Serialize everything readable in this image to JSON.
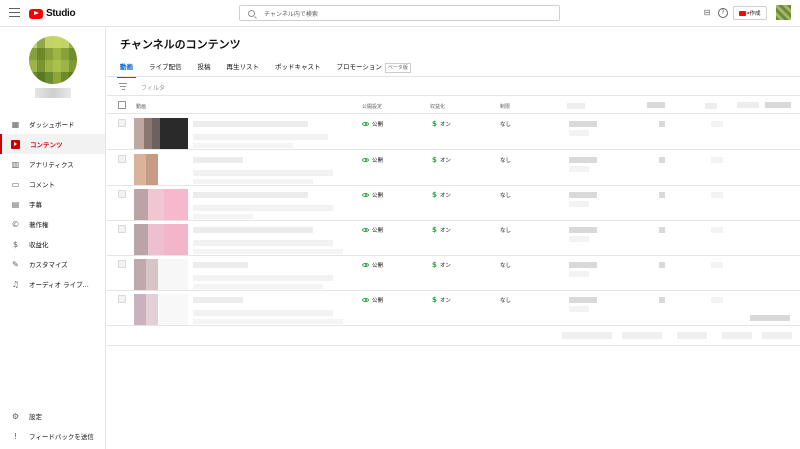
{
  "topbar": {
    "logo_text": "Studio",
    "search_placeholder": "チャンネル内で検索",
    "create_label": "作成"
  },
  "sidebar": {
    "items": [
      {
        "label": "ダッシュボード",
        "icon": "dashboard-icon",
        "glyph": "▦"
      },
      {
        "label": "コンテンツ",
        "icon": "content-icon",
        "glyph": "▶",
        "active": true
      },
      {
        "label": "アナリティクス",
        "icon": "analytics-icon",
        "glyph": "▥"
      },
      {
        "label": "コメント",
        "icon": "comment-icon",
        "glyph": "▭"
      },
      {
        "label": "字幕",
        "icon": "subtitles-icon",
        "glyph": "▤"
      },
      {
        "label": "著作権",
        "icon": "copyright-icon",
        "glyph": "©"
      },
      {
        "label": "収益化",
        "icon": "monetization-icon",
        "glyph": "$"
      },
      {
        "label": "カスタマイズ",
        "icon": "customize-icon",
        "glyph": "✎"
      },
      {
        "label": "オーディオ ライブ...",
        "icon": "audio-library-icon",
        "glyph": "♫"
      }
    ],
    "bottom": [
      {
        "label": "設定",
        "icon": "settings-icon",
        "glyph": "⚙"
      },
      {
        "label": "フィードバックを送信",
        "icon": "feedback-icon",
        "glyph": "!"
      }
    ]
  },
  "main": {
    "title": "チャンネルのコンテンツ",
    "tabs": [
      {
        "label": "動画",
        "active": true
      },
      {
        "label": "ライブ配信"
      },
      {
        "label": "投稿"
      },
      {
        "label": "再生リスト"
      },
      {
        "label": "ポッドキャスト"
      },
      {
        "label": "プロモーション",
        "badge": "ベータ版"
      }
    ],
    "filter_label": "フィルタ",
    "columns": {
      "video": "動画",
      "visibility": "公開設定",
      "monetization": "収益化",
      "restrictions": "制限"
    },
    "rows": [
      {
        "visibility": "公開",
        "monetization": "オン",
        "restrictions": "なし"
      },
      {
        "visibility": "公開",
        "monetization": "オン",
        "restrictions": "なし"
      },
      {
        "visibility": "公開",
        "monetization": "オン",
        "restrictions": "なし"
      },
      {
        "visibility": "公開",
        "monetization": "オン",
        "restrictions": "なし"
      },
      {
        "visibility": "公開",
        "monetization": "オン",
        "restrictions": "なし"
      },
      {
        "visibility": "公開",
        "monetization": "オン",
        "restrictions": "なし"
      }
    ]
  },
  "colors": {
    "accent_red": "#cc0000",
    "tab_blue": "#065fd4",
    "status_green": "#2ba640"
  }
}
